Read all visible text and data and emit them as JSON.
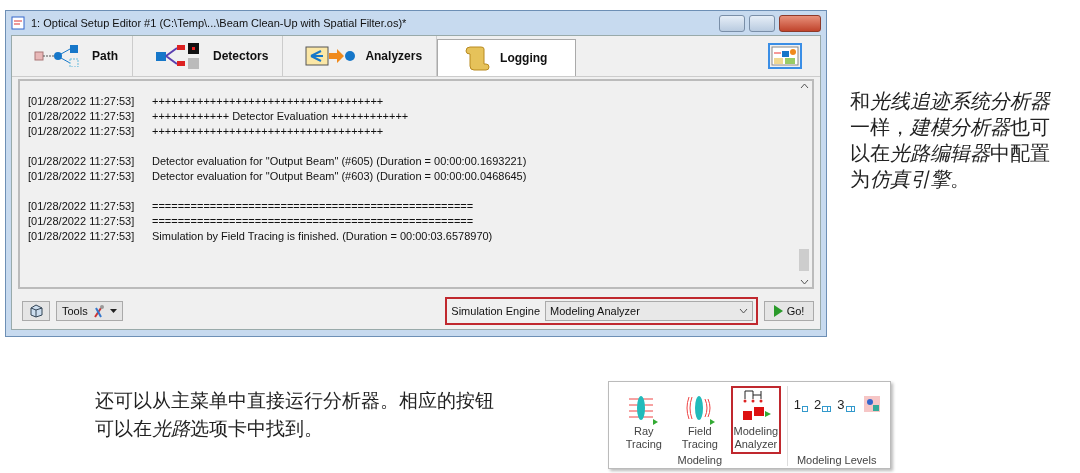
{
  "window": {
    "title": "1: Optical Setup Editor #1 (C:\\Temp\\...\\Beam Clean-Up with Spatial Filter.os)*"
  },
  "tabs": [
    {
      "label": "Path",
      "selected": false
    },
    {
      "label": "Detectors",
      "selected": false
    },
    {
      "label": "Analyzers",
      "selected": false
    },
    {
      "label": "Logging",
      "selected": true
    }
  ],
  "log_blocks": [
    [
      {
        "time": "[01/28/2022 11:27:53]",
        "message": "++++++++++++++++++++++++++++++++++++"
      },
      {
        "time": "[01/28/2022 11:27:53]",
        "message": "++++++++++++ Detector Evaluation ++++++++++++"
      },
      {
        "time": "[01/28/2022 11:27:53]",
        "message": "++++++++++++++++++++++++++++++++++++"
      }
    ],
    [
      {
        "time": "[01/28/2022 11:27:53]",
        "message": "Detector evaluation for \"Output Beam\" (#605) (Duration = 00:00:00.1693221)"
      },
      {
        "time": "[01/28/2022 11:27:53]",
        "message": "Detector evaluation for \"Output Beam\" (#603) (Duration = 00:00:00.0468645)"
      }
    ],
    [
      {
        "time": "[01/28/2022 11:27:53]",
        "message": "=================================================="
      },
      {
        "time": "[01/28/2022 11:27:53]",
        "message": "=================================================="
      },
      {
        "time": "[01/28/2022 11:27:53]",
        "message": "Simulation by Field Tracing is finished. (Duration = 00:00:03.6578970)"
      }
    ]
  ],
  "bottom_bar": {
    "tools_label": "Tools",
    "engine_label": "Simulation Engine",
    "engine_value": "Modeling Analyzer",
    "go_label": "Go!"
  },
  "side_note": [
    {
      "text": "和",
      "italic": false
    },
    {
      "text": "光线追迹系统分析器",
      "italic": true
    },
    {
      "text": "一样，",
      "italic": false
    },
    {
      "text": "建模分析器",
      "italic": true
    },
    {
      "text": "也可以在",
      "italic": false
    },
    {
      "text": "光路编辑器",
      "italic": true
    },
    {
      "text": "中配置为",
      "italic": false
    },
    {
      "text": "仿真引擎",
      "italic": true
    },
    {
      "text": "。",
      "italic": false
    }
  ],
  "bottom_note": [
    {
      "text": "还可以从主菜单中直接运行分析器。相应的按钮可以在",
      "italic": false
    },
    {
      "text": "光路",
      "italic": true
    },
    {
      "text": "选项卡中找到。",
      "italic": false
    }
  ],
  "ribbon": {
    "groups": [
      {
        "label": "Modeling",
        "buttons": [
          {
            "label": "Ray Tracing",
            "highlighted": false
          },
          {
            "label": "Field Tracing",
            "highlighted": false
          },
          {
            "label": "Modeling Analyzer",
            "highlighted": true
          }
        ]
      },
      {
        "label": "Modeling Levels",
        "levels": [
          "1",
          "2",
          "3"
        ]
      }
    ]
  }
}
